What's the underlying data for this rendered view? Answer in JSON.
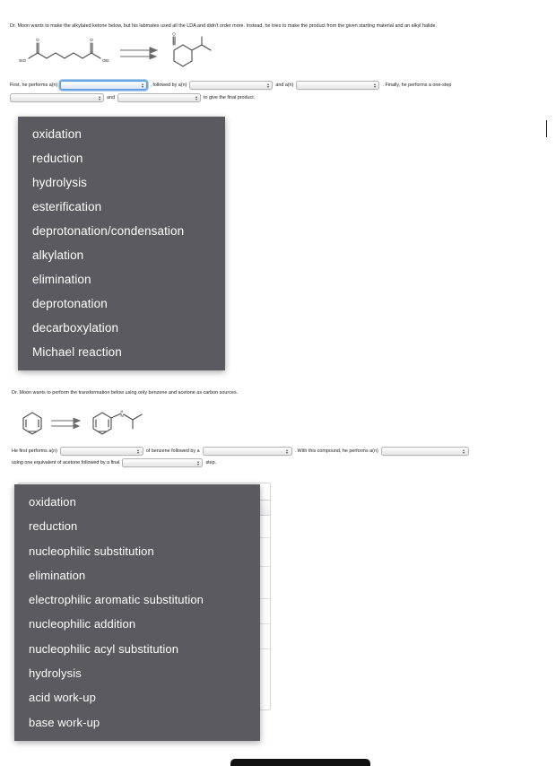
{
  "page": {
    "background_color": "#ffffff",
    "text_color": "#1c1c1c"
  },
  "question1": {
    "prompt": "Dr. Moon wants to make the alkylated ketone below, but his labmates used all the LDA and didn't order more. Instead, he tries to make the product from the given starting material and an alkyl halide.",
    "reaction": {
      "reactant_label_left": "EtO",
      "reactant_label_right": "OEt",
      "reactant_name": "diethyl pimelate",
      "product_name": "2-isopropylcyclohexan-1-one",
      "arrow": "double-arrow-right"
    },
    "sentence": {
      "part1": "First, he performs a(n)",
      "part2": ", followed by a(n)",
      "part3": "and a(n)",
      "part4": ". Finally, he performs a one-step",
      "part5": "and",
      "part6": "to give the final product."
    },
    "selects": [
      {
        "name": "select-1a",
        "value": "",
        "focused": true
      },
      {
        "name": "select-1b",
        "value": "",
        "focused": false
      },
      {
        "name": "select-1c",
        "value": "",
        "focused": false
      },
      {
        "name": "select-1d",
        "value": "",
        "focused": false
      },
      {
        "name": "select-1e",
        "value": "",
        "focused": false
      }
    ],
    "dropdown": {
      "open": true,
      "background_color": "#5a5a60",
      "text_color": "#ffffff",
      "options": [
        "oxidation",
        "reduction",
        "hydrolysis",
        "esterification",
        "deprotonation/condensation",
        "alkylation",
        "elimination",
        "deprotonation",
        "decarboxylation",
        "Michael reaction"
      ]
    }
  },
  "question2": {
    "prompt": "Dr. Moon wants to perform the transformation below using only benzene and acetone as carbon sources.",
    "reaction": {
      "reactant_name": "benzene",
      "product_name": "N-isopropylaniline",
      "product_nh_label": "H",
      "arrow": "double-arrow-right"
    },
    "sentence": {
      "part1": "He first performs a(n)",
      "part2": "of benzene followed by a",
      "part3": ". With this compound, he performs a(n)",
      "part4": "using one equivalent of acetone followed by a final",
      "part5": "step."
    },
    "selects": [
      {
        "name": "select-2a",
        "value": "",
        "focused": false
      },
      {
        "name": "select-2b",
        "value": "",
        "focused": false
      },
      {
        "name": "select-2c",
        "value": "",
        "focused": false
      },
      {
        "name": "select-2d",
        "value": "",
        "focused": false
      }
    ],
    "dropdown": {
      "open": true,
      "background_color": "#5a5a60",
      "text_color": "#ffffff",
      "options": [
        "oxidation",
        "reduction",
        "nucleophilic substitution",
        "elimination",
        "electrophilic aromatic substitution",
        "nucleophilic addition",
        "nucleophilic acyl substitution",
        "hydrolysis",
        "acid work-up",
        "base work-up"
      ]
    },
    "obscured_glyph": "e"
  }
}
